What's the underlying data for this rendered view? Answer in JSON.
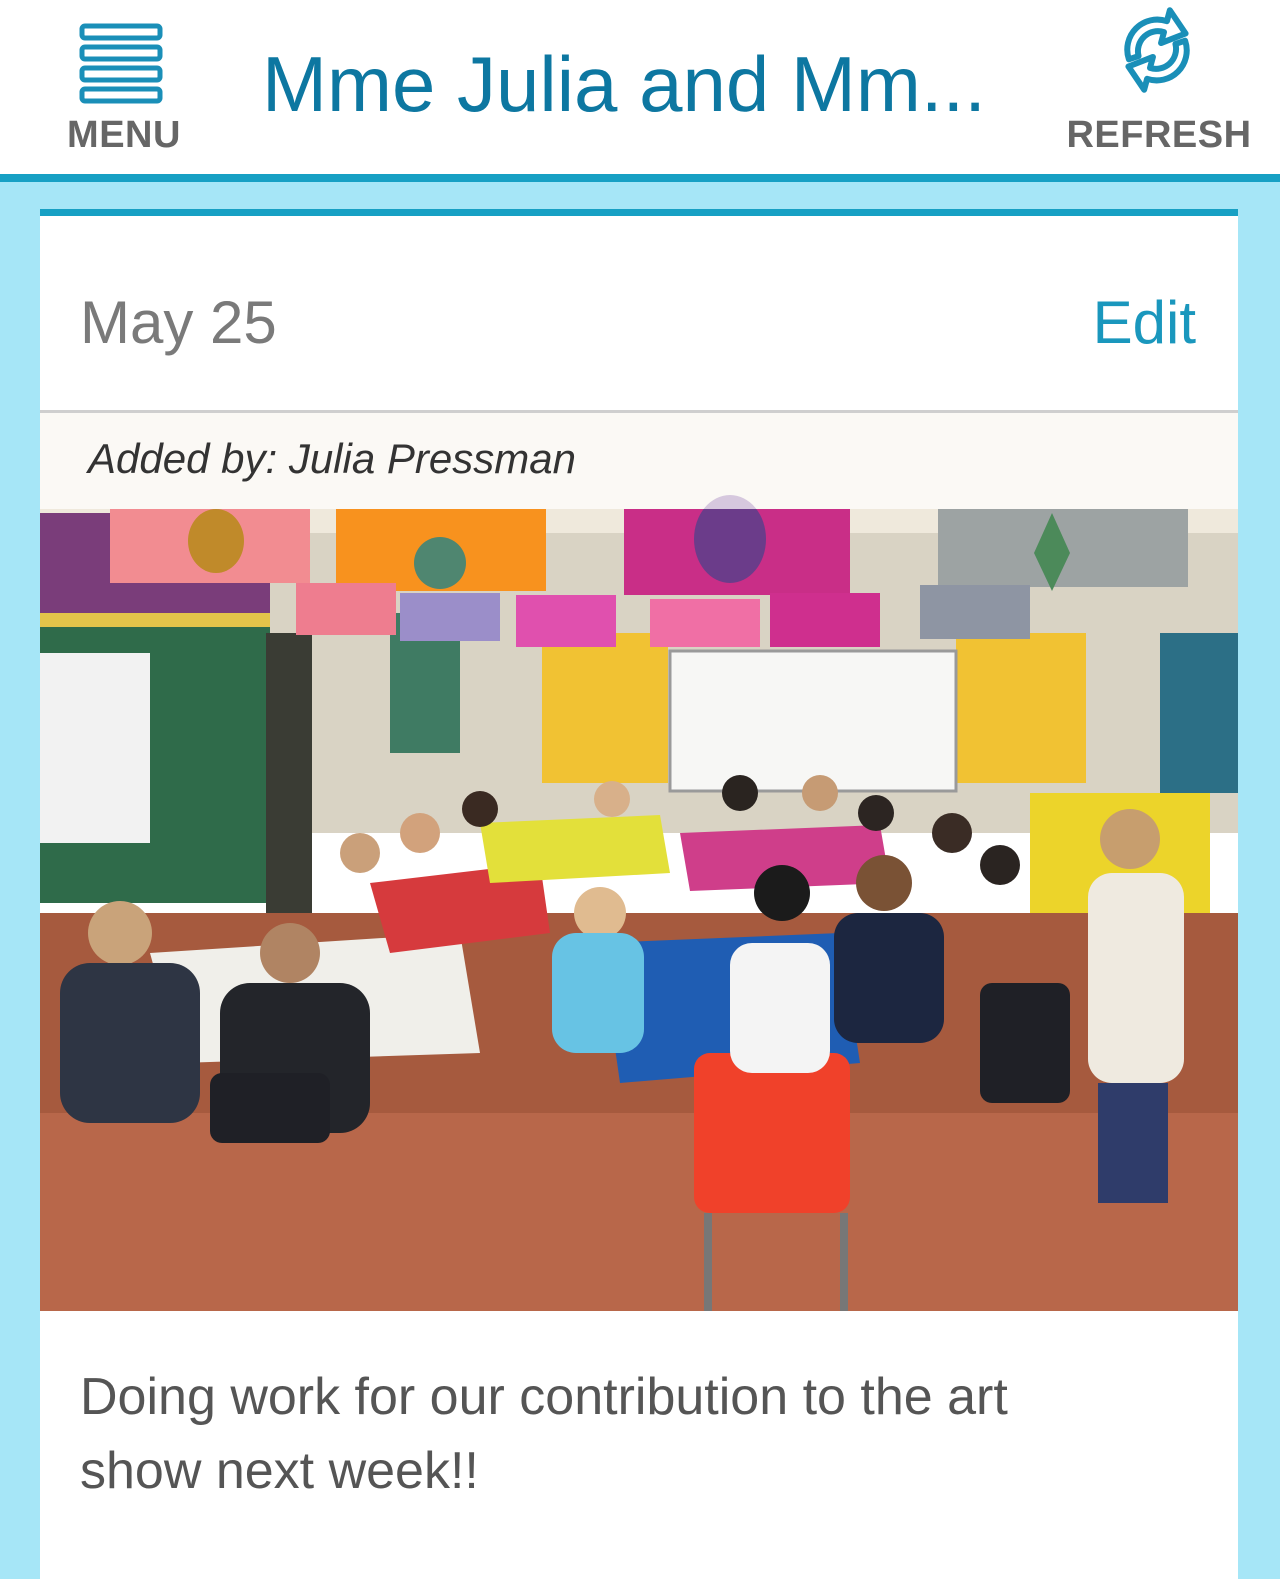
{
  "header": {
    "menu_label": "MENU",
    "title": "Mme Julia and Mm...",
    "refresh_label": "REFRESH"
  },
  "post": {
    "date": "May 25",
    "edit_label": "Edit",
    "added_by": "Added by: Julia Pressman",
    "caption": "Doing work for our contribution to the art show next week!!"
  },
  "colors": {
    "accent": "#17a0c4",
    "title": "#0d77a1",
    "background": "#a6e6f7"
  }
}
